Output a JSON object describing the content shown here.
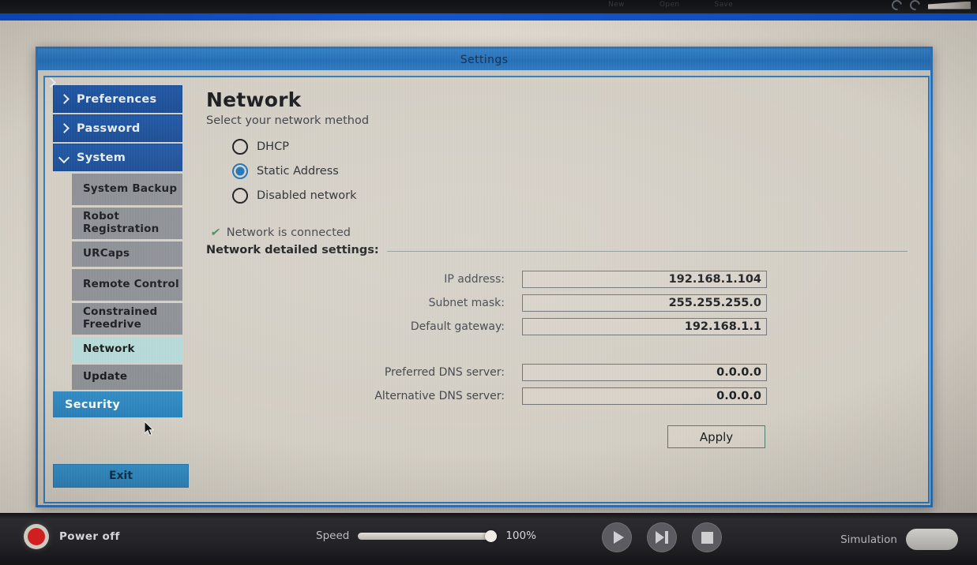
{
  "topbar": {
    "menu_items": [
      "New",
      "Open",
      "Save"
    ],
    "icons": [
      "reload-icon",
      "reload-icon",
      "robot-arm-icon"
    ]
  },
  "dialog": {
    "title": "Settings"
  },
  "sidebar": {
    "top_items": [
      {
        "label": "Preferences",
        "icon": "chevron-right-icon",
        "expanded": false
      },
      {
        "label": "Password",
        "icon": "chevron-right-icon",
        "expanded": false
      },
      {
        "label": "System",
        "icon": "chevron-down-icon",
        "expanded": true
      }
    ],
    "sub_items": [
      {
        "label": "System Backup",
        "active": false
      },
      {
        "label": "Robot Registration",
        "active": false
      },
      {
        "label": "URCaps",
        "active": false
      },
      {
        "label": "Remote Control",
        "active": false
      },
      {
        "label": "Constrained Freedrive",
        "active": false
      },
      {
        "label": "Network",
        "active": true
      },
      {
        "label": "Update",
        "active": false
      }
    ],
    "security": {
      "label": "Security",
      "icon": "chevron-right-icon"
    },
    "exit": {
      "label": "Exit"
    }
  },
  "content": {
    "title": "Network",
    "subtitle": "Select your network method",
    "radio_options": [
      {
        "label": "DHCP",
        "selected": false
      },
      {
        "label": "Static Address",
        "selected": true
      },
      {
        "label": "Disabled network",
        "selected": false
      }
    ],
    "status": {
      "icon": "check-icon",
      "glyph": "✔",
      "text": "Network is connected",
      "color": "#3a8a50"
    },
    "section_title": "Network detailed settings:",
    "fields_primary": [
      {
        "label": "IP address:",
        "value": "192.168.1.104"
      },
      {
        "label": "Subnet mask:",
        "value": "255.255.255.0"
      },
      {
        "label": "Default gateway:",
        "value": "192.168.1.1"
      }
    ],
    "fields_dns": [
      {
        "label": "Preferred DNS server:",
        "value": "0.0.0.0"
      },
      {
        "label": "Alternative DNS server:",
        "value": "0.0.0.0"
      }
    ],
    "apply": {
      "label": "Apply"
    }
  },
  "bottombar": {
    "power": {
      "label": "Power off",
      "icon": "power-off-icon",
      "color": "#cf1f1f"
    },
    "speed": {
      "label": "Speed",
      "value": "100%",
      "percent": 100
    },
    "transport": [
      {
        "name": "play-button",
        "icon": "play-icon"
      },
      {
        "name": "step-button",
        "icon": "step-forward-icon"
      },
      {
        "name": "stop-button",
        "icon": "stop-icon"
      }
    ],
    "simulation": {
      "label": "Simulation",
      "enabled": false
    }
  },
  "colors": {
    "accent_blue": "#2b7cc0",
    "nav_blue": "#1c56a6",
    "security_blue": "#2f8cc6",
    "active_item": "#b6dbd9",
    "radio_selected": "#1470b8",
    "status_green": "#3a8a50",
    "panel_bg": "#d5cfc5"
  }
}
